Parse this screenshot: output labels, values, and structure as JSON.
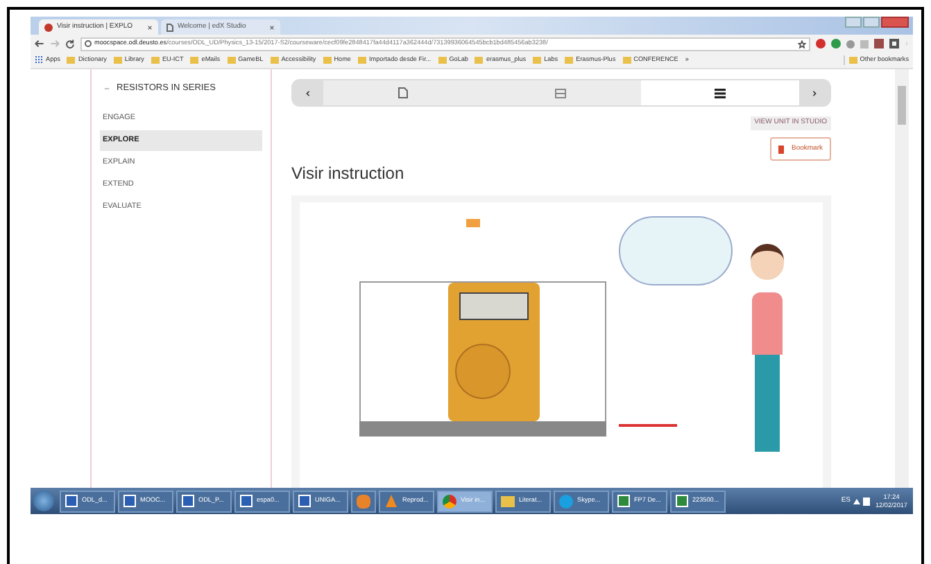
{
  "browser": {
    "tabs": [
      {
        "label": "Visir instruction | EXPLO",
        "selected": true
      },
      {
        "label": "Welcome | edX Studio",
        "selected": false
      }
    ],
    "url": {
      "host": "moocspace.odl.deusto.es",
      "path": "/courses/ODL_UD/Physics_13-15/2017-S2/courseware/cecf09fe2848417fa44d4117a362444d/73139936064545bcb1bd485456ab3238/"
    },
    "bookmarks": [
      {
        "label": "Apps",
        "kind": "apps"
      },
      {
        "label": "Dictionary",
        "kind": "folder"
      },
      {
        "label": "Library",
        "kind": "folder"
      },
      {
        "label": "EU-ICT",
        "kind": "folder"
      },
      {
        "label": "eMails",
        "kind": "folder"
      },
      {
        "label": "GameBL",
        "kind": "folder"
      },
      {
        "label": "Accessibility",
        "kind": "folder"
      },
      {
        "label": "Home",
        "kind": "folder"
      },
      {
        "label": "Importado desde Fir...",
        "kind": "folder"
      },
      {
        "label": "GoLab",
        "kind": "folder"
      },
      {
        "label": "erasmus_plus",
        "kind": "folder"
      },
      {
        "label": "Labs",
        "kind": "folder"
      },
      {
        "label": "Erasmus-Plus",
        "kind": "folder"
      },
      {
        "label": "CONFERENCE",
        "kind": "folder"
      },
      {
        "label": "»",
        "kind": "more"
      },
      {
        "label": "Other bookmarks",
        "kind": "folder"
      }
    ]
  },
  "sidebar": {
    "section": {
      "label": "RESISTORS IN SERIES",
      "expanded": true
    },
    "items": [
      {
        "label": "ENGAGE",
        "selected": false
      },
      {
        "label": "EXPLORE",
        "selected": true
      },
      {
        "label": "EXPLAIN",
        "selected": false
      },
      {
        "label": "EXTEND",
        "selected": false
      },
      {
        "label": "EVALUATE",
        "selected": false
      }
    ]
  },
  "unit_nav": {
    "tabs": [
      {
        "kind": "document",
        "selected": false
      },
      {
        "kind": "video",
        "selected": false
      },
      {
        "kind": "list",
        "selected": true
      }
    ]
  },
  "view_unit_button": "VIEW UNIT IN STUDIO",
  "bookmark_button": "Bookmark",
  "heading": "Visir instruction",
  "taskbar": {
    "items": [
      {
        "label": "ODL_d...",
        "kind": "word",
        "selected": false
      },
      {
        "label": "MOOC...",
        "kind": "word",
        "selected": false
      },
      {
        "label": "ODL_P...",
        "kind": "word",
        "selected": false
      },
      {
        "label": "espa0...",
        "kind": "word",
        "selected": false
      },
      {
        "label": "UNIGA...",
        "kind": "word",
        "selected": false
      },
      {
        "kind": "media",
        "selected": false
      },
      {
        "label": "Reprod...",
        "kind": "vlc",
        "selected": false
      },
      {
        "label": "Visir in...",
        "kind": "chrome",
        "selected": true
      },
      {
        "label": "Literat...",
        "kind": "folder",
        "selected": false
      },
      {
        "label": "Skype...",
        "kind": "skype",
        "selected": false
      },
      {
        "label": "FP7 De...",
        "kind": "excel",
        "selected": false
      },
      {
        "label": "223500...",
        "kind": "excel",
        "selected": false
      }
    ],
    "language": "ES",
    "time": "17:24",
    "date": "12/02/2017"
  }
}
